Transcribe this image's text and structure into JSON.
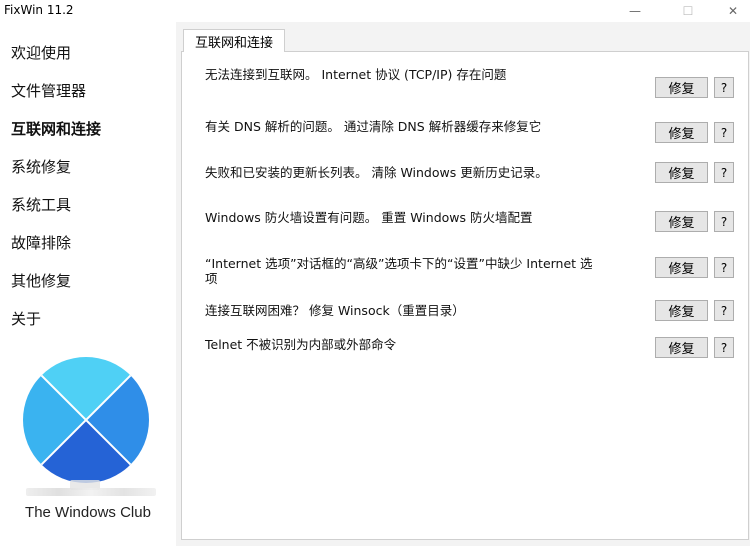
{
  "window": {
    "title": "FixWin 11.2",
    "min_glyph": "—",
    "max_glyph": "☐",
    "close_glyph": "✕"
  },
  "sidebar": {
    "items": [
      {
        "label": "欢迎使用"
      },
      {
        "label": "文件管理器"
      },
      {
        "label": "互联网和连接",
        "active": true
      },
      {
        "label": "系统修复"
      },
      {
        "label": "系统工具"
      },
      {
        "label": "故障排除"
      },
      {
        "label": "其他修复"
      },
      {
        "label": "关于"
      }
    ],
    "brand": "The Windows Club"
  },
  "colors": {
    "logo_top": "#4fd0f5",
    "logo_left": "#3ab3f0",
    "logo_right": "#2f8ee8",
    "logo_bottom": "#2563d6"
  },
  "tab": {
    "label": "互联网和连接"
  },
  "fixes": [
    {
      "text": "无法连接到互联网。 Internet 协议 (TCP/IP) 存在问题",
      "button": "修复",
      "help": "?"
    },
    {
      "text": "有关 DNS 解析的问题。 通过清除 DNS 解析器缓存来修复它",
      "button": "修复",
      "help": "?"
    },
    {
      "text": "失败和已安装的更新长列表。 清除 Windows 更新历史记录。",
      "button": "修复",
      "help": "?"
    },
    {
      "text": "Windows 防火墙设置有问题。 重置 Windows 防火墙配置",
      "button": "修复",
      "help": "?"
    },
    {
      "text": "“Internet 选项”对话框的“高级”选项卡下的“设置”中缺少 Internet 选项",
      "button": "修复",
      "help": "?"
    },
    {
      "text": "连接互联网困难？ 修复 Winsock（重置目录）",
      "button": "修复",
      "help": "?"
    },
    {
      "text": "Telnet 不被识别为内部或外部命令",
      "button": "修复",
      "help": "?"
    }
  ]
}
